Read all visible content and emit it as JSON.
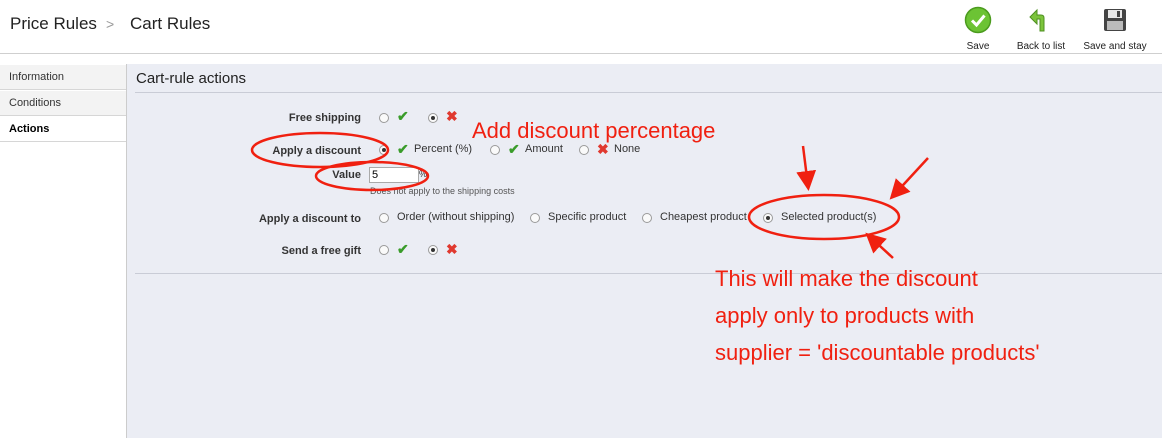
{
  "breadcrumb": {
    "first": "Price Rules",
    "separator": ">",
    "second": "Cart Rules"
  },
  "toolbar": {
    "save": {
      "label": "Save",
      "icon": "save-icon"
    },
    "back": {
      "label": "Back to list",
      "icon": "back-arrow-icon"
    },
    "save_stay": {
      "label": "Save and stay",
      "icon": "floppy-disk-icon"
    }
  },
  "tabs": [
    {
      "label": "Information",
      "active": false
    },
    {
      "label": "Conditions",
      "active": false
    },
    {
      "label": "Actions",
      "active": true
    }
  ],
  "panel": {
    "title": "Cart-rule actions",
    "free_shipping": {
      "label": "Free shipping",
      "selected": "no"
    },
    "apply_discount": {
      "label": "Apply a discount",
      "options": [
        "Percent (%)",
        "Amount",
        "None"
      ],
      "selected": "Percent (%)"
    },
    "value": {
      "label": "Value",
      "input": "5",
      "unit": "%",
      "hint": "Does not apply to the shipping costs"
    },
    "apply_to": {
      "label": "Apply a discount to",
      "options": [
        "Order (without shipping)",
        "Specific product",
        "Cheapest product",
        "Selected product(s)"
      ],
      "selected": "Selected product(s)"
    },
    "free_gift": {
      "label": "Send a free gift",
      "selected": "no"
    }
  },
  "annotations": {
    "title": "Add discount percentage",
    "note_line1": "This will make the discount",
    "note_line2": "apply only to products with",
    "note_line3": "supplier = 'discountable products'",
    "color": "#f02010"
  },
  "colors": {
    "check": "#3a9c2a",
    "cross": "#e0392f",
    "panel_bg": "#ebedf4"
  }
}
